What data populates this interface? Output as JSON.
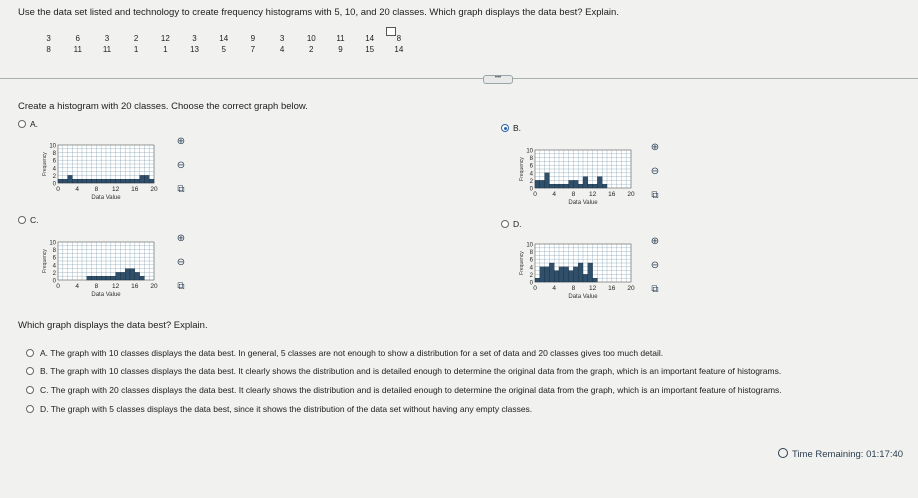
{
  "question": "Use the data set listed and technology to create frequency histograms with 5, 10, and 20 classes. Which graph displays the data best? Explain.",
  "data_rows": [
    [
      "3",
      "6",
      "3",
      "2",
      "12",
      "3",
      "14",
      "9",
      "3",
      "10",
      "11",
      "14",
      "8"
    ],
    [
      "8",
      "11",
      "11",
      "1",
      "1",
      "13",
      "5",
      "7",
      "4",
      "2",
      "9",
      "15",
      "14"
    ]
  ],
  "instruction": "Create a histogram with 20 classes. Choose the correct graph below.",
  "expand_handle": "•••",
  "graph_options": [
    {
      "letter": "A.",
      "selected": false
    },
    {
      "letter": "B.",
      "selected": true
    },
    {
      "letter": "C.",
      "selected": false
    },
    {
      "letter": "D.",
      "selected": false
    }
  ],
  "chart_data": [
    {
      "option": "A",
      "type": "bar",
      "xlim": [
        0,
        20
      ],
      "ylim": [
        0,
        10
      ],
      "xticks": [
        "0",
        "4",
        "8",
        "12",
        "16",
        "20"
      ],
      "yticks": [
        "0",
        "2",
        "4",
        "6",
        "8",
        "10"
      ],
      "xlabel": "Data Value",
      "ylabel": "Frequency",
      "values": [
        1,
        1,
        2,
        1,
        1,
        1,
        1,
        1,
        1,
        1,
        1,
        1,
        1,
        1,
        1,
        1,
        1,
        2,
        2,
        1
      ]
    },
    {
      "option": "B",
      "type": "bar",
      "xlim": [
        0,
        20
      ],
      "ylim": [
        0,
        10
      ],
      "xticks": [
        "0",
        "4",
        "8",
        "12",
        "16",
        "20"
      ],
      "yticks": [
        "0",
        "2",
        "4",
        "6",
        "8",
        "10"
      ],
      "xlabel": "Data Value",
      "ylabel": "Frequency",
      "values": [
        2,
        2,
        4,
        1,
        1,
        1,
        1,
        2,
        2,
        1,
        3,
        1,
        1,
        3,
        1,
        0,
        0,
        0,
        0,
        0
      ]
    },
    {
      "option": "C",
      "type": "bar",
      "xlim": [
        0,
        20
      ],
      "ylim": [
        0,
        10
      ],
      "xticks": [
        "0",
        "4",
        "8",
        "12",
        "16",
        "20"
      ],
      "yticks": [
        "0",
        "2",
        "4",
        "6",
        "8",
        "10"
      ],
      "xlabel": "Data Value",
      "ylabel": "Frequency",
      "values": [
        0,
        0,
        0,
        0,
        0,
        0,
        1,
        1,
        1,
        1,
        1,
        1,
        2,
        2,
        3,
        3,
        2,
        1,
        0,
        0
      ]
    },
    {
      "option": "D",
      "type": "bar",
      "xlim": [
        0,
        20
      ],
      "ylim": [
        0,
        10
      ],
      "xticks": [
        "0",
        "4",
        "8",
        "12",
        "16",
        "20"
      ],
      "yticks": [
        "0",
        "2",
        "4",
        "6",
        "8",
        "10"
      ],
      "xlabel": "Data Value",
      "ylabel": "Frequency",
      "values": [
        1,
        4,
        4,
        5,
        3,
        4,
        4,
        3,
        4,
        5,
        2,
        5,
        1,
        0,
        0,
        0,
        0,
        0,
        0,
        0
      ]
    }
  ],
  "prompt2": "Which graph displays the data best? Explain.",
  "answers": [
    {
      "letter": "A.",
      "text": "The graph with 10 classes displays the data best. In general, 5 classes are not enough to show a distribution for a set of data and 20 classes gives too much detail."
    },
    {
      "letter": "B.",
      "text": "The graph with 10 classes displays the data best. It clearly shows the distribution and is detailed enough to determine the original data from the graph, which is an important feature of histograms."
    },
    {
      "letter": "C.",
      "text": "The graph with 20 classes displays the data best. It clearly shows the distribution and is detailed enough to determine the original data from the graph, which is an important feature of histograms."
    },
    {
      "letter": "D.",
      "text": "The graph with 5 classes displays the data best, since it shows the distribution of the data set without having any empty classes."
    }
  ],
  "timer": "Time Remaining: 01:17:40",
  "colors": {
    "bar": "#2f4f6b",
    "grid": "#7d9cad",
    "selected": "#2a62a8",
    "icon": "#2b3f55"
  },
  "icons": {
    "zoom_in": "zoom-in-icon",
    "zoom_out": "zoom-out-icon",
    "popout": "popout-icon",
    "copy": "copy-icon",
    "clock": "clock-icon"
  }
}
